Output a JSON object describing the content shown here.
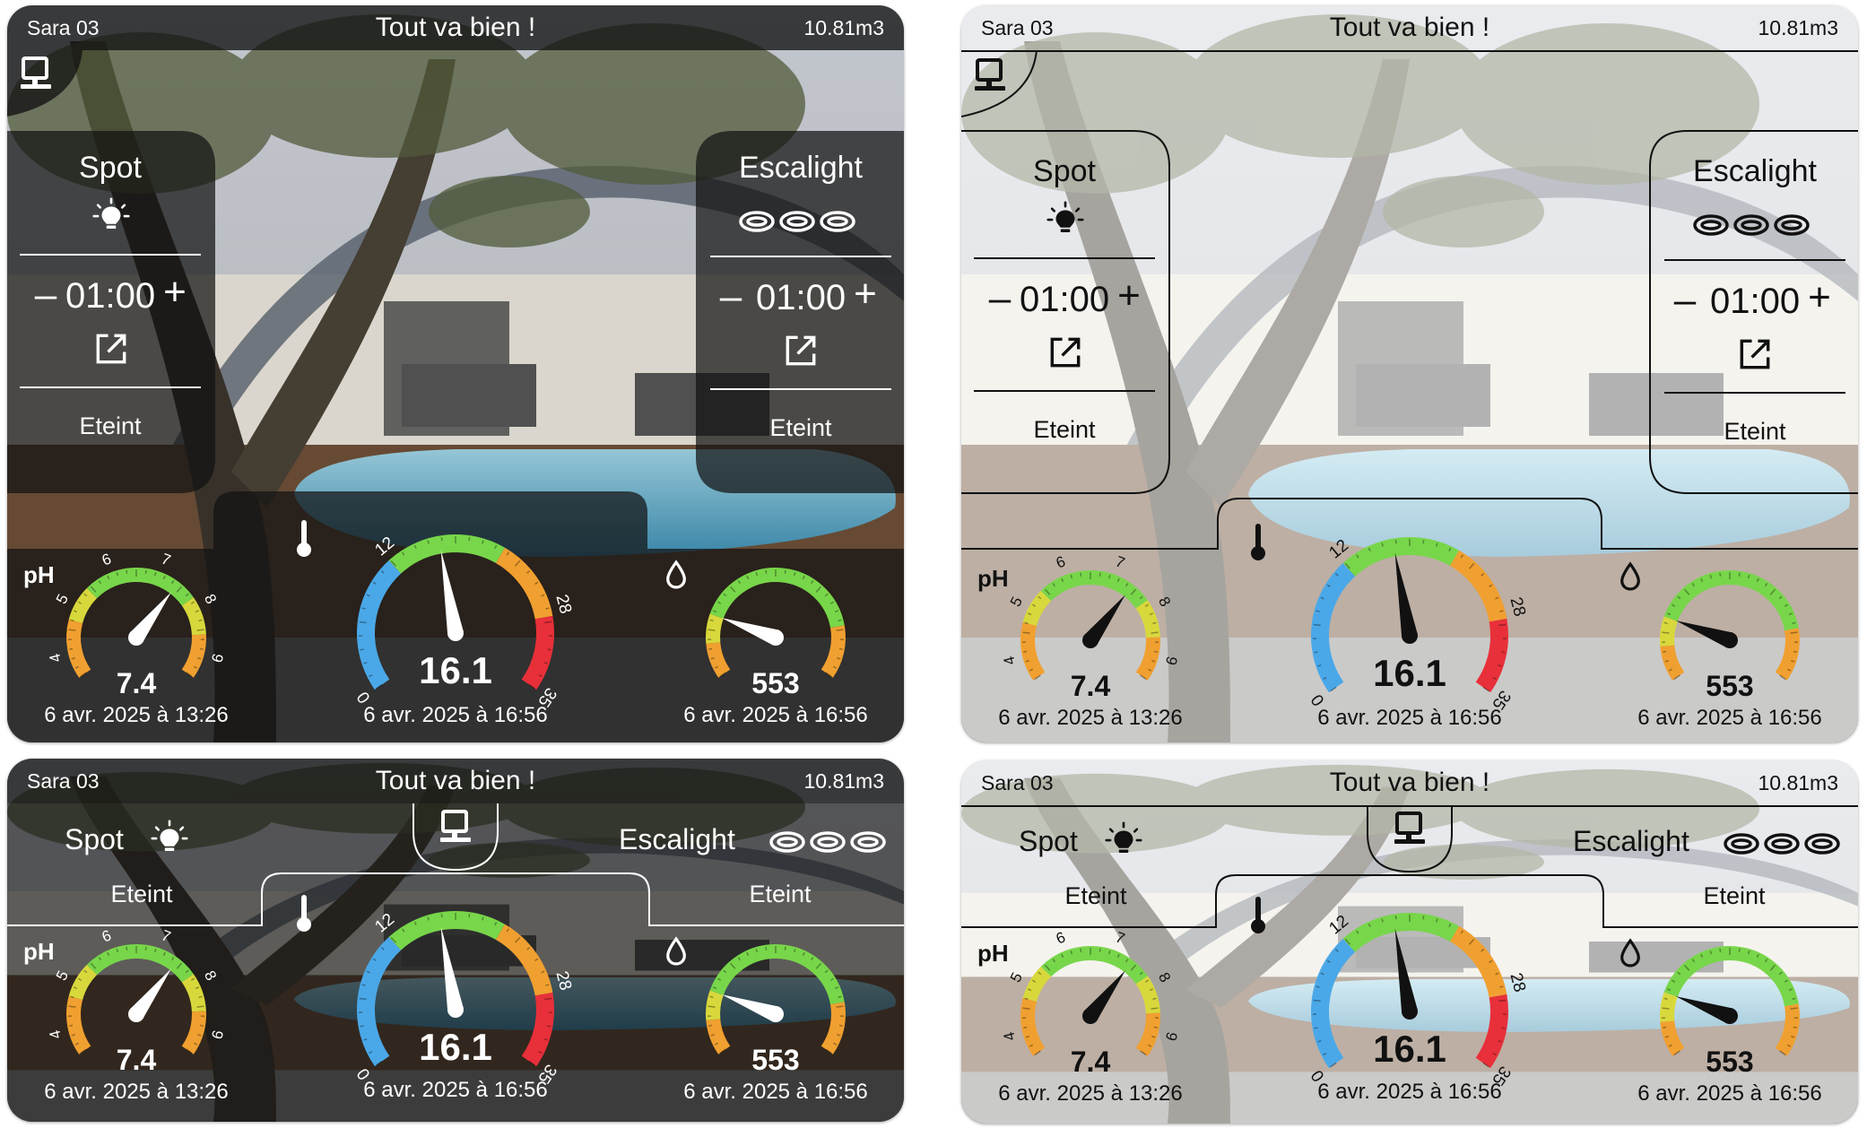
{
  "header": {
    "name": "Sara 03",
    "status": "Tout va bien !",
    "volume": "10.81m3"
  },
  "spot": {
    "label": "Spot",
    "timer": "01:00",
    "state": "Eteint",
    "icon": "light-bulb-icon"
  },
  "escalight": {
    "label": "Escalight",
    "timer": "01:00",
    "state": "Eteint",
    "icon": "ring-lights-icon"
  },
  "ph": {
    "label": "pH",
    "value": "7.4",
    "date": "6 avr. 2025 à 13:26",
    "ticks": [
      "4",
      "5",
      "6",
      "7",
      "8",
      "9"
    ],
    "needle_value": 7.4,
    "min": 3.5,
    "max": 9.5
  },
  "temperature": {
    "value": "16.1",
    "date": "6 avr. 2025 à 16:56",
    "ticks": [
      "0",
      "12",
      "28",
      "35"
    ],
    "needle_value": 16.1,
    "min": 0,
    "max": 35,
    "icon": "thermometer-icon"
  },
  "orp": {
    "value": "553",
    "date": "6 avr. 2025 à 16:56",
    "needle_value": 553,
    "icon": "water-drop-icon"
  },
  "colors": {
    "cold": "#4aa8e8",
    "green": "#78d64a",
    "yellow": "#d8d83c",
    "orange": "#f0a030",
    "red": "#e8303a"
  }
}
